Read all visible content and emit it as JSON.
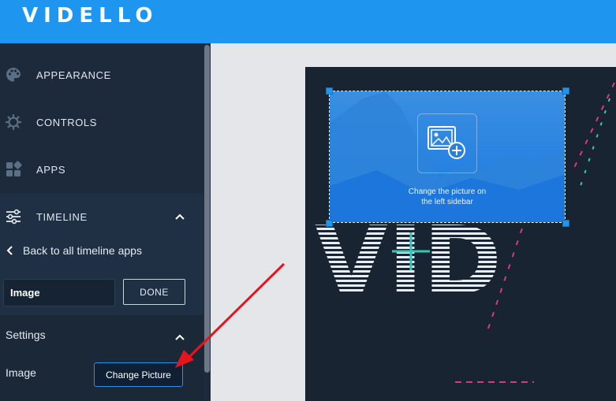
{
  "app": {
    "title": "VIDELLO"
  },
  "sidebar": {
    "nav": [
      {
        "label": "APPEARANCE",
        "icon": "palette-icon"
      },
      {
        "label": "CONTROLS",
        "icon": "gear-icon"
      },
      {
        "label": "APPS",
        "icon": "apps-icon"
      },
      {
        "label": "TIMELINE",
        "icon": "sliders-icon"
      }
    ],
    "back_label": "Back to all timeline apps",
    "name_value": "Image",
    "done_label": "DONE",
    "settings": {
      "title": "Settings",
      "image_label": "Image",
      "change_label": "Change Picture"
    }
  },
  "canvas": {
    "placeholder_line1": "Change the picture on",
    "placeholder_line2": "the left sidebar",
    "background_text": "VID"
  },
  "colors": {
    "header": "#1e96f0",
    "sidebar": "#1c2a3b",
    "accent": "#2f8ee8",
    "arrow": "#e8141b"
  }
}
